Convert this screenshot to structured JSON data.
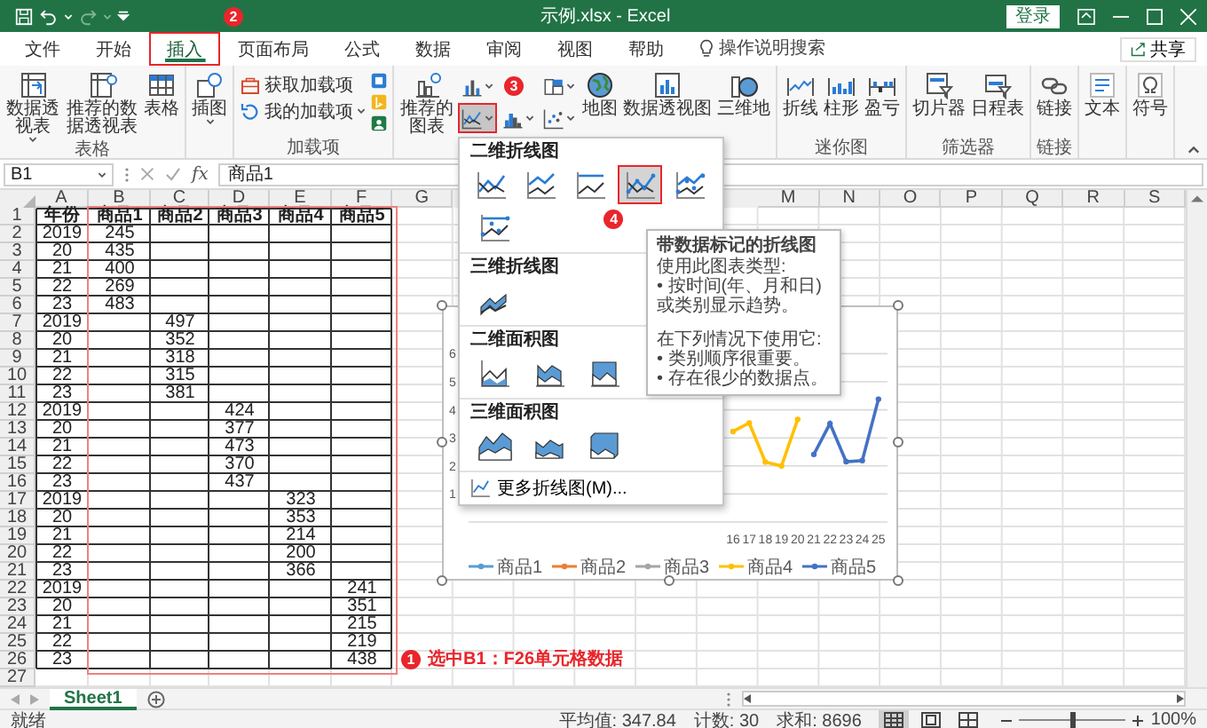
{
  "window": {
    "title": "示例.xlsx  -  Excel",
    "sign_in": "登录"
  },
  "quick_access": {
    "redo_disabled": true
  },
  "menu_tabs": [
    {
      "label": "文件",
      "selected": false,
      "marked": false
    },
    {
      "label": "开始",
      "selected": false,
      "marked": false
    },
    {
      "label": "插入",
      "selected": true,
      "marked": true,
      "annotation": "2"
    },
    {
      "label": "页面布局",
      "selected": false,
      "marked": false
    },
    {
      "label": "公式",
      "selected": false,
      "marked": false
    },
    {
      "label": "数据",
      "selected": false,
      "marked": false
    },
    {
      "label": "审阅",
      "selected": false,
      "marked": false
    },
    {
      "label": "视图",
      "selected": false,
      "marked": false
    },
    {
      "label": "帮助",
      "selected": false,
      "marked": false
    }
  ],
  "tell_me": {
    "placeholder": "操作说明搜索"
  },
  "share": "共享",
  "ribbon": [
    {
      "label": "表格",
      "items": [
        {
          "kind": "pivottable",
          "label": "数据透视表",
          "two_line": true,
          "dropdown": true
        },
        {
          "kind": "recpivot",
          "label": "推荐的数据透视表",
          "two_line": true,
          "dropdown": false
        },
        {
          "kind": "table",
          "label": "表格",
          "two_line": false,
          "dropdown": false
        }
      ]
    },
    {
      "items": [
        {
          "kind": "illustrations",
          "label": "插图",
          "two_line": false,
          "dropdown": true
        }
      ]
    },
    {
      "label": "加载项",
      "items": [
        {
          "kind": "getaddins",
          "label": "获取加载项",
          "dropdown": false
        },
        {
          "kind": "myaddins",
          "label": "我的加载项",
          "dropdown": true
        },
        {
          "kind": "addinicons"
        }
      ]
    },
    {
      "items": [
        {
          "kind": "recchart",
          "label": "推荐的图表",
          "two_line": true,
          "dropdown": false
        },
        {
          "kind": "chartgrid",
          "buttons": [
            {
              "kind": "column",
              "open": false,
              "marked": false
            },
            {
              "kind": "hierarchy",
              "open": false,
              "marked": false
            },
            {
              "kind": "line",
              "open": true,
              "marked": true,
              "annotation": "3"
            },
            {
              "kind": "statistic",
              "open": false,
              "marked": false
            },
            {
              "kind": "scatter",
              "open": false,
              "marked": false
            }
          ]
        },
        {
          "kind": "map",
          "label": "地图",
          "two_line": false,
          "dropdown": false
        },
        {
          "kind": "pivotchart",
          "label": "数据透视图",
          "two_line": false,
          "dropdown": false
        },
        {
          "kind": "map3d",
          "label": "三维地",
          "two_line": false,
          "dropdown": false
        }
      ]
    },
    {
      "label": "迷你图",
      "items": [
        {
          "kind": "sparkline",
          "label": "折线",
          "two_line": false,
          "dropdown": false
        },
        {
          "kind": "columnsparkline",
          "label": "柱形",
          "two_line": false,
          "dropdown": false
        },
        {
          "kind": "winloss",
          "label": "盈亏",
          "two_line": false,
          "dropdown": false
        }
      ]
    },
    {
      "label": "筛选器",
      "items": [
        {
          "kind": "slicer",
          "label": "切片器",
          "two_line": false,
          "dropdown": false
        },
        {
          "kind": "timeline",
          "label": "日程表",
          "two_line": false,
          "dropdown": false
        }
      ]
    },
    {
      "label": "链接",
      "items": [
        {
          "kind": "link",
          "label": "链接",
          "two_line": false,
          "dropdown": false
        }
      ]
    },
    {
      "items": [
        {
          "kind": "textbox",
          "label": "文本",
          "two_line": false,
          "dropdown": false
        }
      ]
    },
    {
      "items": [
        {
          "kind": "symbol",
          "label": "符号",
          "two_line": false,
          "dropdown": false
        }
      ]
    }
  ],
  "formula_bar": {
    "name_box": "B1",
    "function_label": "fx",
    "value": "商品1"
  },
  "sheet": {
    "columns": [
      "A",
      "B",
      "C",
      "D",
      "E",
      "F",
      "G"
    ],
    "far_columns": [
      "M",
      "N",
      "O",
      "P",
      "Q",
      "R",
      "S"
    ],
    "rows": [
      {
        "header": "1",
        "cells": [
          "年份",
          "商品1",
          "商品2",
          "商品3",
          "商品4",
          "商品5"
        ]
      },
      {
        "header": "2",
        "cells": [
          "2019",
          "245",
          null,
          null,
          null,
          null
        ]
      },
      {
        "header": "3",
        "cells": [
          "20",
          "435",
          null,
          null,
          null,
          null
        ]
      },
      {
        "header": "4",
        "cells": [
          "21",
          "400",
          null,
          null,
          null,
          null
        ]
      },
      {
        "header": "5",
        "cells": [
          "22",
          "269",
          null,
          null,
          null,
          null
        ]
      },
      {
        "header": "6",
        "cells": [
          "23",
          "483",
          null,
          null,
          null,
          null
        ]
      },
      {
        "header": "7",
        "cells": [
          "2019",
          null,
          "497",
          null,
          null,
          null
        ]
      },
      {
        "header": "8",
        "cells": [
          "20",
          null,
          "352",
          null,
          null,
          null
        ]
      },
      {
        "header": "9",
        "cells": [
          "21",
          null,
          "318",
          null,
          null,
          null
        ]
      },
      {
        "header": "10",
        "cells": [
          "22",
          null,
          "315",
          null,
          null,
          null
        ]
      },
      {
        "header": "11",
        "cells": [
          "23",
          null,
          "381",
          null,
          null,
          null
        ]
      },
      {
        "header": "12",
        "cells": [
          "2019",
          null,
          null,
          "424",
          null,
          null
        ]
      },
      {
        "header": "13",
        "cells": [
          "20",
          null,
          null,
          "377",
          null,
          null
        ]
      },
      {
        "header": "14",
        "cells": [
          "21",
          null,
          null,
          "473",
          null,
          null
        ]
      },
      {
        "header": "15",
        "cells": [
          "22",
          null,
          null,
          "370",
          null,
          null
        ]
      },
      {
        "header": "16",
        "cells": [
          "23",
          null,
          null,
          "437",
          null,
          null
        ]
      },
      {
        "header": "17",
        "cells": [
          "2019",
          null,
          null,
          null,
          "323",
          null
        ]
      },
      {
        "header": "18",
        "cells": [
          "20",
          null,
          null,
          null,
          "353",
          null
        ]
      },
      {
        "header": "19",
        "cells": [
          "21",
          null,
          null,
          null,
          "214",
          null
        ]
      },
      {
        "header": "20",
        "cells": [
          "22",
          null,
          null,
          null,
          "200",
          null
        ]
      },
      {
        "header": "21",
        "cells": [
          "23",
          null,
          null,
          null,
          "366",
          null
        ]
      },
      {
        "header": "22",
        "cells": [
          "2019",
          null,
          null,
          null,
          null,
          "241"
        ]
      },
      {
        "header": "23",
        "cells": [
          "20",
          null,
          null,
          null,
          null,
          "351"
        ]
      },
      {
        "header": "24",
        "cells": [
          "21",
          null,
          null,
          null,
          null,
          "215"
        ]
      },
      {
        "header": "25",
        "cells": [
          "22",
          null,
          null,
          null,
          null,
          "219"
        ]
      },
      {
        "header": "26",
        "cells": [
          "23",
          null,
          null,
          null,
          null,
          "438"
        ]
      },
      {
        "header": "27"
      }
    ]
  },
  "chart": {
    "y_labels": [
      "6",
      "5",
      "4",
      "3",
      "2",
      "1"
    ],
    "x_labels": [
      "16",
      "17",
      "18",
      "19",
      "20",
      "21",
      "22",
      "23",
      "24",
      "25"
    ],
    "legend": [
      {
        "label": "商品1",
        "color": "#5b9bd5"
      },
      {
        "label": "商品2",
        "color": "#ed7d31"
      },
      {
        "label": "商品3",
        "color": "#a5a5a5"
      },
      {
        "label": "商品4",
        "color": "#ffc000"
      },
      {
        "label": "商品5",
        "color": "#4472c4"
      }
    ]
  },
  "chart_menu": {
    "sections": [
      {
        "heading": "二维折线图",
        "options": [
          {
            "kind": "line",
            "selected": false,
            "marked": false
          },
          {
            "kind": "stackedline",
            "selected": false,
            "marked": false
          },
          {
            "kind": "percentline",
            "selected": false,
            "marked": false
          },
          {
            "kind": "markerline",
            "selected": true,
            "marked": true,
            "annotation": "4"
          },
          {
            "kind": "stackedmarkerline",
            "selected": false,
            "marked": false
          },
          {
            "kind": "percentmarkerline",
            "selected": false,
            "marked": false
          }
        ]
      },
      {
        "heading": "三维折线图",
        "options": [
          {
            "kind": "line3d",
            "selected": false,
            "marked": false
          }
        ]
      },
      {
        "heading": "二维面积图",
        "options": [
          {
            "kind": "area",
            "selected": false,
            "marked": false
          },
          {
            "kind": "stackedarea",
            "selected": false,
            "marked": false
          },
          {
            "kind": "percentarea",
            "selected": false,
            "marked": false
          }
        ]
      },
      {
        "heading": "三维面积图",
        "options": [
          {
            "kind": "area3d",
            "selected": false,
            "marked": false
          },
          {
            "kind": "stackedarea3d",
            "selected": false,
            "marked": false
          },
          {
            "kind": "percentarea3d",
            "selected": false,
            "marked": false
          }
        ]
      }
    ],
    "more": "更多折线图(M)..."
  },
  "tooltip": {
    "title": "带数据标记的折线图",
    "paragraphs": [
      [
        "使用此图表类型:",
        "• 按时间(年、月和日)",
        "或类别显示趋势。"
      ],
      [
        "在下列情况下使用它:",
        "• 类别顺序很重要。",
        "• 存在很少的数据点。"
      ]
    ]
  },
  "note": {
    "annotation": "1",
    "text": "选中B1：F26单元格数据",
    "marked": true
  },
  "sheet_tabs": [
    {
      "label": "Sheet1",
      "selected": true
    }
  ],
  "status_bar": {
    "mode": "就绪",
    "average": "平均值: 347.84",
    "count": "计数: 30",
    "sum": "求和: 8696",
    "views": [
      {
        "kind": "normal",
        "selected": true
      },
      {
        "kind": "pagelayout",
        "selected": false
      },
      {
        "kind": "pagebreak",
        "selected": false
      }
    ],
    "zoom": {
      "level": 0.5
    },
    "zoom_label": "100%"
  }
}
